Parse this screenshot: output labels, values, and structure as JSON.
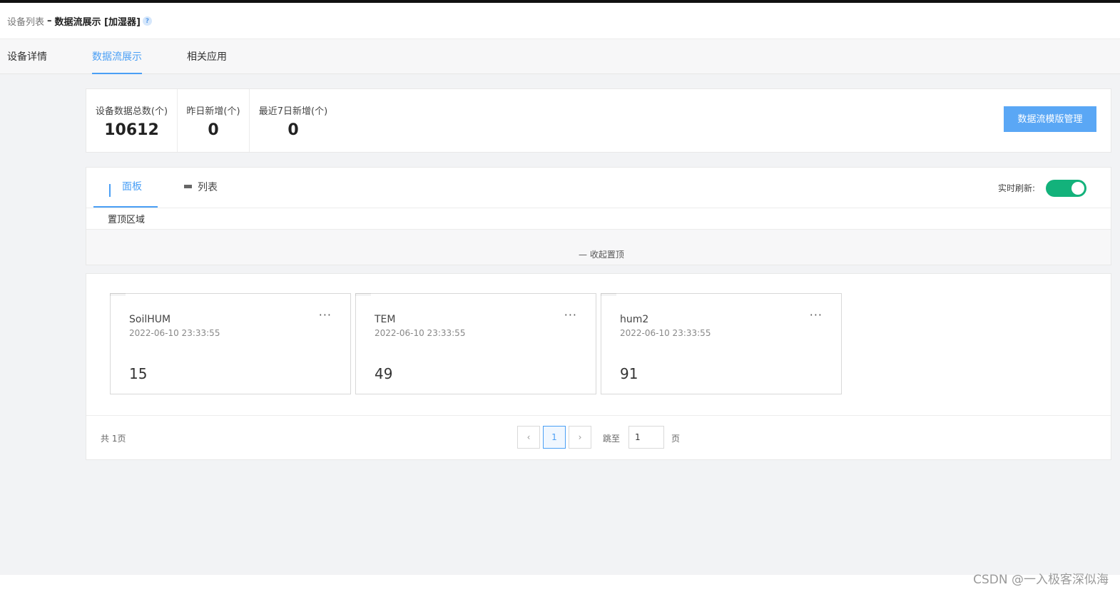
{
  "breadcrumb": {
    "parent": "设备列表",
    "separator": "–",
    "current": "数据流展示 [加湿器]",
    "help": "?"
  },
  "tabs": [
    {
      "label": "设备详情",
      "active": false
    },
    {
      "label": "数据流展示",
      "active": true
    },
    {
      "label": "相关应用",
      "active": false
    }
  ],
  "stats": [
    {
      "label": "设备数据总数(个)",
      "value": "10612"
    },
    {
      "label": "昨日新增(个)",
      "value": "0"
    },
    {
      "label": "最近7日新增(个)",
      "value": "0"
    }
  ],
  "template_button": "数据流模版管理",
  "view_tabs": [
    {
      "label": "面板",
      "icon": "grid-icon",
      "active": true
    },
    {
      "label": "列表",
      "icon": "list-icon",
      "active": false
    }
  ],
  "refresh": {
    "label": "实时刷新:",
    "enabled": true,
    "color": "#13b27b"
  },
  "pin": {
    "title": "置顶区域",
    "collapse_label": "— 收起置顶"
  },
  "cards": [
    {
      "name": "SoilHUM",
      "time": "2022-06-10 23:33:55",
      "value": "15",
      "more": "···"
    },
    {
      "name": "TEM",
      "time": "2022-06-10 23:33:55",
      "value": "49",
      "more": "···"
    },
    {
      "name": "hum2",
      "time": "2022-06-10 23:33:55",
      "value": "91",
      "more": "···"
    }
  ],
  "pagination": {
    "total": "共 1页",
    "prev": "‹",
    "current": "1",
    "next": "›",
    "jump_label": "跳至",
    "jump_value": "1",
    "page_suffix": "页"
  },
  "watermark": "CSDN @一入极客深似海",
  "colors": {
    "accent": "#4a9ff5",
    "button": "#5aa7f5",
    "toggle_on": "#13b27b"
  }
}
